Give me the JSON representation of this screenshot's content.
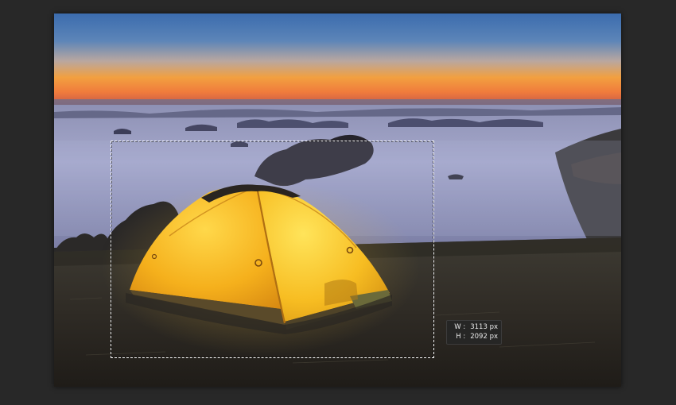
{
  "colors": {
    "workspace_bg": "#282828",
    "tent_glow": "#f5b21a",
    "sky_top": "#3c6fb0",
    "horizon": "#f07a3a"
  },
  "canvas": {
    "content": "photo-of-illuminated-tent-above-fog-valley"
  },
  "selection": {
    "tool": "rectangular-marquee",
    "hud": {
      "width_label": "W :",
      "width_value": "3113 px",
      "height_label": "H :",
      "height_value": "2092 px"
    }
  }
}
